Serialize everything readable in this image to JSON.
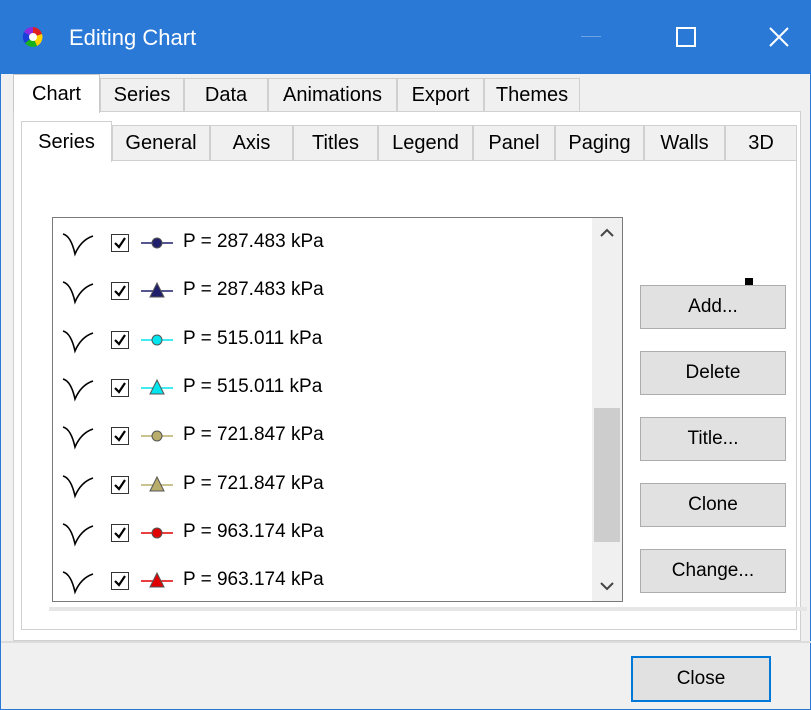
{
  "window": {
    "title": "Editing Chart",
    "colors": {
      "titlebar": "#2b79d7",
      "focus_border": "#0078d7"
    }
  },
  "main_tabs": [
    {
      "label": "Chart",
      "active": true
    },
    {
      "label": "Series"
    },
    {
      "label": "Data"
    },
    {
      "label": "Animations"
    },
    {
      "label": "Export"
    },
    {
      "label": "Themes"
    }
  ],
  "sub_tabs": [
    {
      "label": "Series",
      "active": true
    },
    {
      "label": "General"
    },
    {
      "label": "Axis"
    },
    {
      "label": "Titles"
    },
    {
      "label": "Legend"
    },
    {
      "label": "Panel"
    },
    {
      "label": "Paging"
    },
    {
      "label": "Walls"
    },
    {
      "label": "3D"
    }
  ],
  "series_list": [
    {
      "label": "P = 287.483 kPa",
      "checked": true,
      "marker": "circle",
      "color": "#1f1f6b"
    },
    {
      "label": "P = 287.483 kPa",
      "checked": true,
      "marker": "triangle",
      "color": "#1f1f6b"
    },
    {
      "label": "P = 515.011 kPa",
      "checked": true,
      "marker": "circle",
      "color": "#00e5ee"
    },
    {
      "label": "P = 515.011 kPa",
      "checked": true,
      "marker": "triangle",
      "color": "#00e5ee"
    },
    {
      "label": "P = 721.847 kPa",
      "checked": true,
      "marker": "circle",
      "color": "#b8ad6a"
    },
    {
      "label": "P = 721.847 kPa",
      "checked": true,
      "marker": "triangle",
      "color": "#b8ad6a"
    },
    {
      "label": "P = 963.174 kPa",
      "checked": true,
      "marker": "circle",
      "color": "#e00000"
    },
    {
      "label": "P = 963.174 kPa",
      "checked": true,
      "marker": "triangle",
      "color": "#e00000"
    }
  ],
  "buttons": {
    "add": "Add...",
    "delete": "Delete",
    "title": "Title...",
    "clone": "Clone",
    "change": "Change...",
    "close": "Close"
  },
  "icons": {
    "move_up": "step-up-icon",
    "move_down": "arrow-down-icon"
  }
}
